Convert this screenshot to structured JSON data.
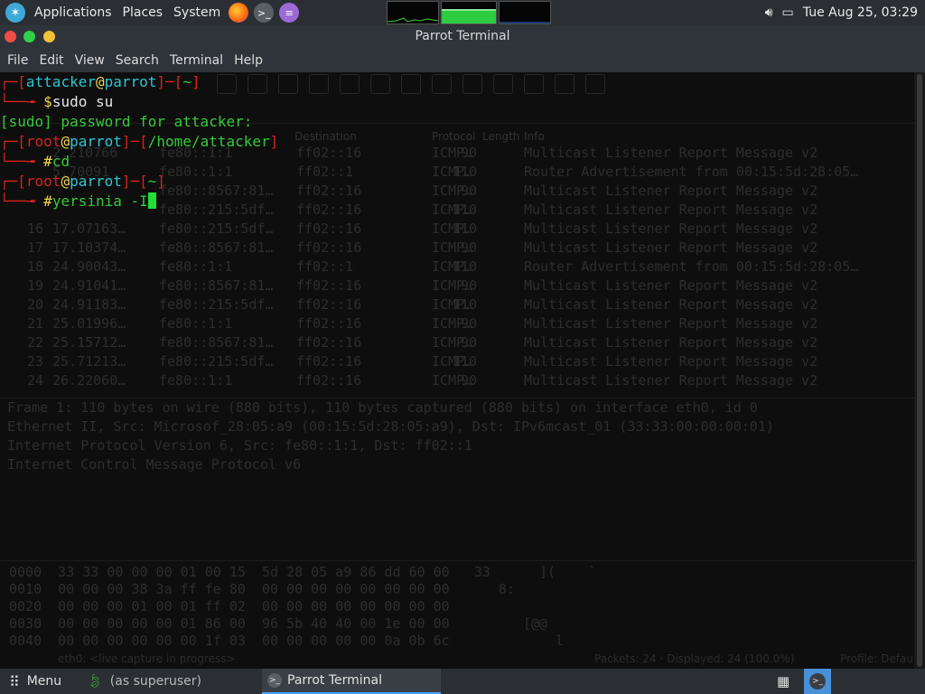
{
  "top_panel": {
    "applications": "Applications",
    "places": "Places",
    "system": "System",
    "clock": "Tue Aug 25, 03:29"
  },
  "window": {
    "title": "Parrot Terminal"
  },
  "menubar": [
    "File",
    "Edit",
    "View",
    "Search",
    "Terminal",
    "Help"
  ],
  "terminal": {
    "lines": [
      {
        "user": "attacker",
        "host": "parrot",
        "dir": "~",
        "symbol": "$",
        "cmd": "sudo su"
      },
      {
        "plain": "[sudo] password for attacker:"
      },
      {
        "user": "root",
        "host": "parrot",
        "dir": "/home/attacker",
        "symbol": "#",
        "cmd": "cd"
      },
      {
        "user": "root",
        "host": "parrot",
        "dir": "~",
        "symbol": "#",
        "cmd": "yersinia -I"
      }
    ]
  },
  "background_capture": {
    "headers": {
      "destination": "Destination",
      "protocol": "Protocol",
      "length": "Length",
      "info": "Info"
    },
    "rows": [
      {
        "no": "",
        "time": "2.210766",
        "src": "fe80::1:1",
        "dst": "ff02::16",
        "proto": "ICMP…",
        "len": "90",
        "info": "Multicast Listener Report Message v2"
      },
      {
        "no": "",
        "time": "5.70091",
        "src": "fe80::1:1",
        "dst": "ff02::1",
        "proto": "ICMP…",
        "len": "110",
        "info": "Router Advertisement from 00:15:5d:28:05…"
      },
      {
        "no": "",
        "time": "",
        "src": "fe80::8567:81…",
        "dst": "ff02::16",
        "proto": "ICMP…",
        "len": "90",
        "info": "Multicast Listener Report Message v2"
      },
      {
        "no": "",
        "time": "",
        "src": "fe80::215:5df…",
        "dst": "ff02::16",
        "proto": "ICMP…",
        "len": "110",
        "info": "Multicast Listener Report Message v2"
      },
      {
        "no": "16",
        "time": "17.07163…",
        "src": "fe80::215:5df…",
        "dst": "ff02::16",
        "proto": "ICMP…",
        "len": "110",
        "info": "Multicast Listener Report Message v2"
      },
      {
        "no": "17",
        "time": "17.10374…",
        "src": "fe80::8567:81…",
        "dst": "ff02::16",
        "proto": "ICMP…",
        "len": "90",
        "info": "Multicast Listener Report Message v2"
      },
      {
        "no": "18",
        "time": "24.90043…",
        "src": "fe80::1:1",
        "dst": "ff02::1",
        "proto": "ICMP…",
        "len": "110",
        "info": "Router Advertisement from 00:15:5d:28:05…"
      },
      {
        "no": "19",
        "time": "24.91041…",
        "src": "fe80::8567:81…",
        "dst": "ff02::16",
        "proto": "ICMP…",
        "len": "90",
        "info": "Multicast Listener Report Message v2"
      },
      {
        "no": "20",
        "time": "24.91183…",
        "src": "fe80::215:5df…",
        "dst": "ff02::16",
        "proto": "ICMP…",
        "len": "110",
        "info": "Multicast Listener Report Message v2"
      },
      {
        "no": "21",
        "time": "25.01996…",
        "src": "fe80::1:1",
        "dst": "ff02::16",
        "proto": "ICMP…",
        "len": "90",
        "info": "Multicast Listener Report Message v2"
      },
      {
        "no": "22",
        "time": "25.15712…",
        "src": "fe80::8567:81…",
        "dst": "ff02::16",
        "proto": "ICMP…",
        "len": "90",
        "info": "Multicast Listener Report Message v2"
      },
      {
        "no": "23",
        "time": "25.71213…",
        "src": "fe80::215:5df…",
        "dst": "ff02::16",
        "proto": "ICMP…",
        "len": "110",
        "info": "Multicast Listener Report Message v2"
      },
      {
        "no": "24",
        "time": "26.22060…",
        "src": "fe80::1:1",
        "dst": "ff02::16",
        "proto": "ICMP…",
        "len": "90",
        "info": "Multicast Listener Report Message v2"
      }
    ],
    "details": [
      "Frame 1: 110 bytes on wire (880 bits), 110 bytes captured (880 bits) on interface eth0, id 0",
      "Ethernet II, Src: Microsof_28:05:a9 (00:15:5d:28:05:a9), Dst: IPv6mcast_01 (33:33:00:00:00:01)",
      "Internet Protocol Version 6, Src: fe80::1:1, Dst: ff02::1",
      "Internet Control Message Protocol v6"
    ],
    "hex": [
      "0000  33 33 00 00 00 01 00 15  5d 28 05 a9 86 dd 60 00   33      ](    `",
      "0010  00 00 00 38 3a ff fe 80  00 00 00 00 00 00 00 00      8:",
      "0020  00 00 00 01 00 01 ff 02  00 00 00 00 00 00 00 00",
      "0030  00 00 00 00 00 01 86 00  96 5b 40 40 00 1e 00 00         [@@",
      "0040  00 00 00 00 00 00 1f 03  00 00 00 00 00 0a 0b 6c             l"
    ],
    "status_left": "eth0: <live capture in progress>",
    "status_mid": "Packets: 24 · Displayed: 24 (100.0%)",
    "status_right": "Profile: Defau"
  },
  "bottom_panel": {
    "menu": "Menu",
    "task1": "(as superuser)",
    "task2": "Parrot Terminal"
  }
}
